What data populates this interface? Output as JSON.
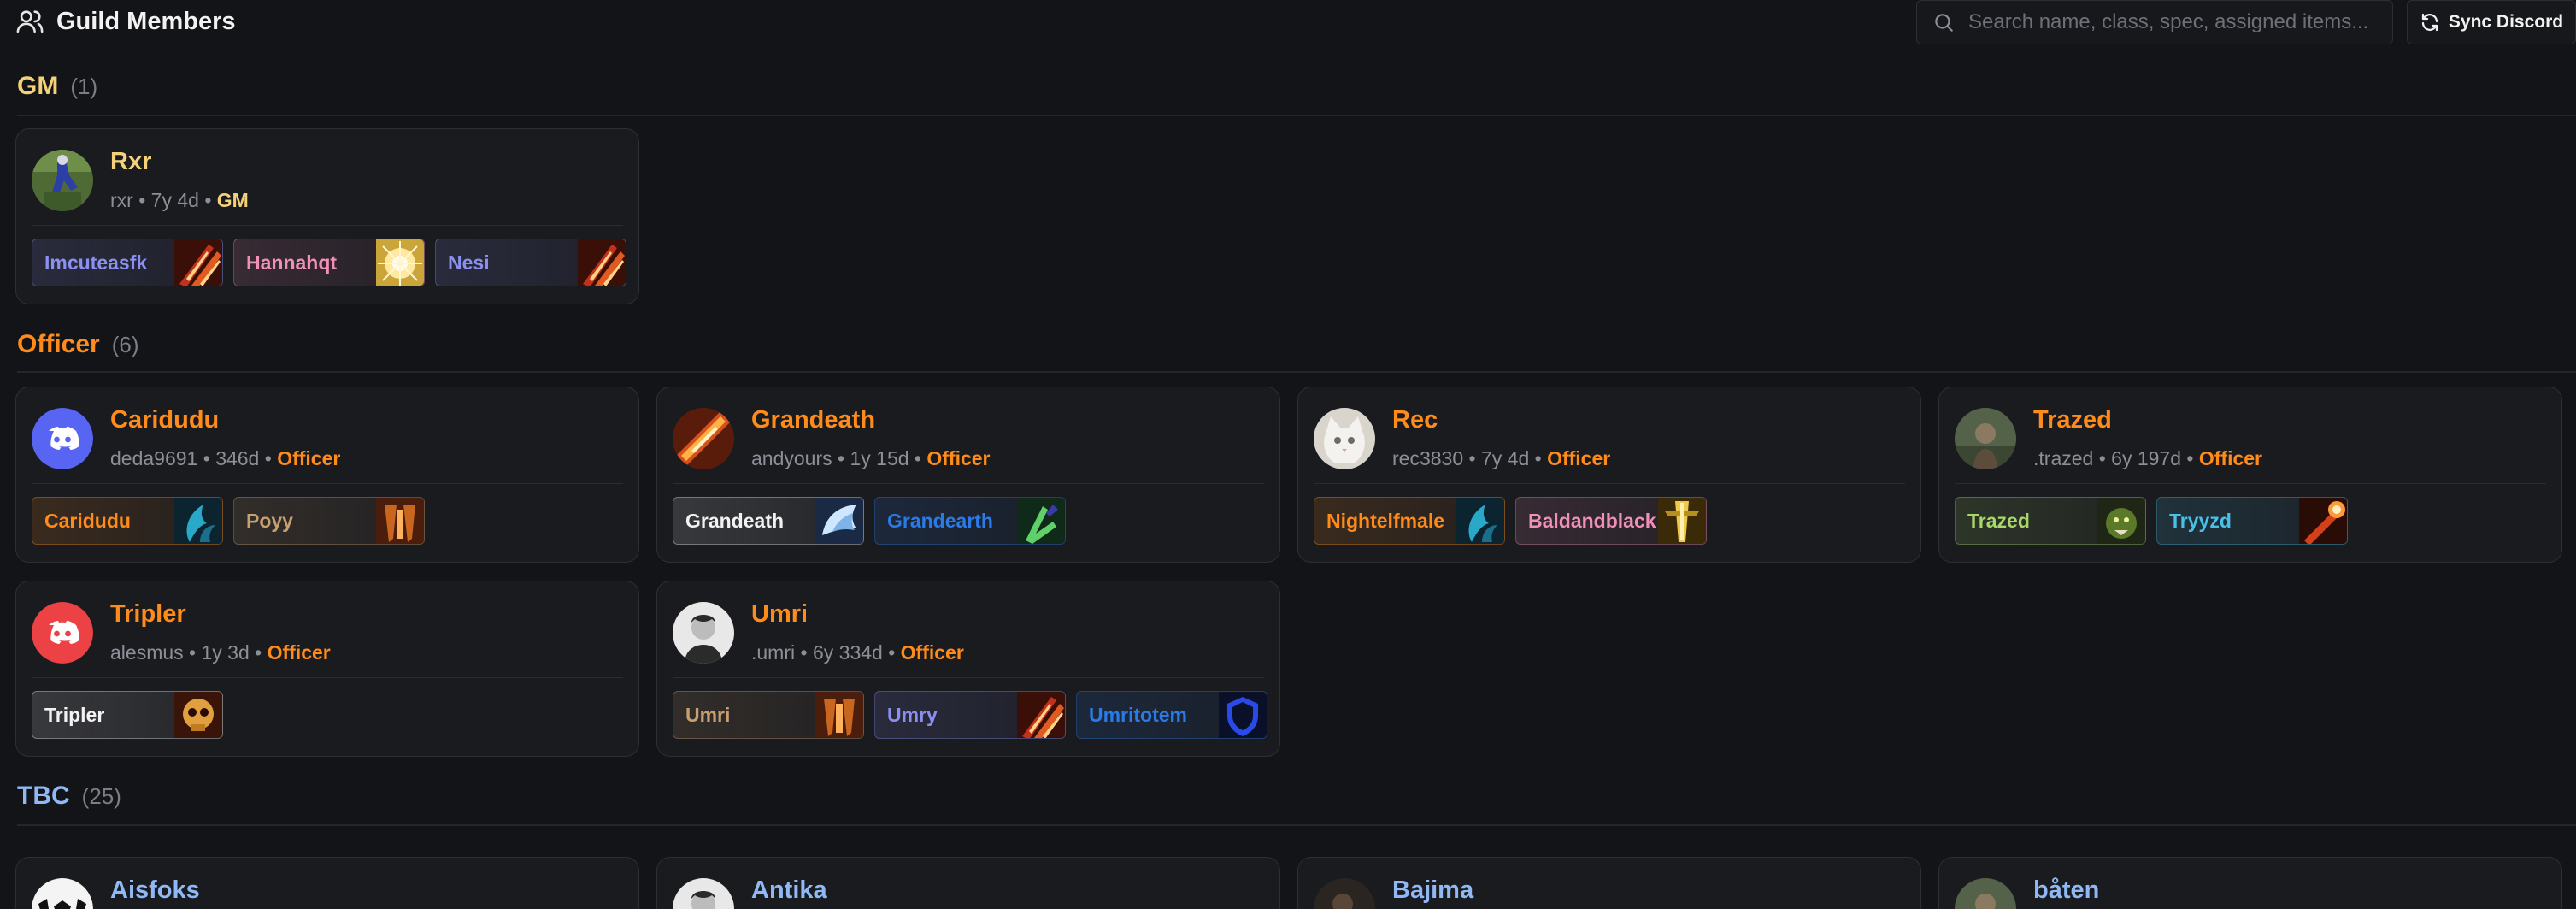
{
  "header": {
    "title": "Guild Members",
    "search_placeholder": "Search name, class, spec, assigned items...",
    "sync_label": "Sync Discord"
  },
  "colors": {
    "gm": "#f5d27a",
    "officer": "#ff8c1a",
    "tbc": "#8fb8f5",
    "warlock": "#8a8ff0",
    "paladin": "#f08fb8",
    "druid": "#ff8c1a",
    "warrior": "#c8a070",
    "priest": "#f2f2f2",
    "shaman": "#2a7ae8",
    "hunter": "#a8d86a",
    "mage": "#48c0e8"
  },
  "sections": [
    {
      "name": "GM",
      "count": "(1)",
      "members": [
        {
          "name": "Rxr",
          "username": "rxr",
          "tenure": "7y 4d",
          "role": "GM",
          "avatar": "player-photo",
          "characters": [
            {
              "name": "Imcuteasfk",
              "class": "warlock",
              "icon": "destruction-flame-icon"
            },
            {
              "name": "Hannahqt",
              "class": "paladin",
              "icon": "holy-light-icon"
            },
            {
              "name": "Nesi",
              "class": "warlock",
              "icon": "destruction-flame-icon"
            }
          ]
        }
      ]
    },
    {
      "name": "Officer",
      "count": "(6)",
      "members": [
        {
          "name": "Caridudu",
          "username": "deda9691",
          "tenure": "346d",
          "role": "Officer",
          "avatar": "discord-avatar",
          "characters": [
            {
              "name": "Caridudu",
              "class": "druid",
              "icon": "feral-claw-icon"
            },
            {
              "name": "Poyy",
              "class": "warrior",
              "icon": "arms-weapon-icon"
            }
          ]
        },
        {
          "name": "Grandeath",
          "username": "andyours",
          "tenure": "1y 15d",
          "role": "Officer",
          "avatar": "fire-spell-avatar",
          "characters": [
            {
              "name": "Grandeath",
              "class": "priest",
              "icon": "discipline-shield-icon"
            },
            {
              "name": "Grandearth",
              "class": "shaman",
              "icon": "enhancement-icon"
            }
          ]
        },
        {
          "name": "Rec",
          "username": "rec3830",
          "tenure": "7y 4d",
          "role": "Officer",
          "avatar": "cat-photo",
          "characters": [
            {
              "name": "Nightelfmale",
              "class": "druid",
              "icon": "feral-claw-icon"
            },
            {
              "name": "Baldandblack",
              "class": "paladin",
              "icon": "retribution-icon"
            }
          ]
        },
        {
          "name": "Trazed",
          "username": ".trazed",
          "tenure": "6y 197d",
          "role": "Officer",
          "avatar": "character-portrait",
          "characters": [
            {
              "name": "Trazed",
              "class": "hunter",
              "icon": "beast-mastery-icon"
            },
            {
              "name": "Tryyzd",
              "class": "mage",
              "icon": "fire-mage-icon"
            }
          ]
        },
        {
          "name": "Tripler",
          "username": "alesmus",
          "tenure": "1y 3d",
          "role": "Officer",
          "avatar": "discord-avatar-red",
          "characters": [
            {
              "name": "Tripler",
              "class": "priest",
              "icon": "shadow-skull-icon"
            }
          ]
        },
        {
          "name": "Umri",
          "username": ".umri",
          "tenure": "6y 334d",
          "role": "Officer",
          "avatar": "person-photo",
          "characters": [
            {
              "name": "Umri",
              "class": "warrior",
              "icon": "arms-weapon-icon"
            },
            {
              "name": "Umry",
              "class": "warlock",
              "icon": "destruction-flame-icon"
            },
            {
              "name": "Umritotem",
              "class": "shaman",
              "icon": "restoration-shield-icon"
            }
          ]
        }
      ]
    },
    {
      "name": "TBC",
      "count": "(25)",
      "members": [
        {
          "name": "Aisfoks",
          "avatar": "soccer-ball-avatar"
        },
        {
          "name": "Antika",
          "avatar": "person-photo"
        },
        {
          "name": "Bajima",
          "avatar": "dark-photo"
        },
        {
          "name": "båten",
          "avatar": "character-portrait"
        }
      ]
    }
  ]
}
